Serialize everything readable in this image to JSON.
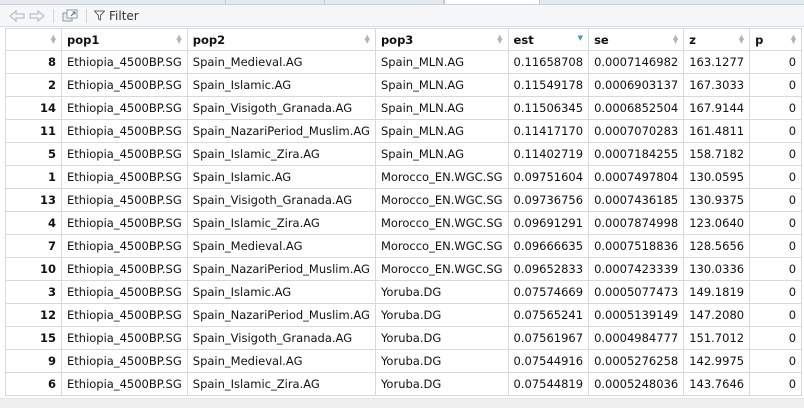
{
  "toolbar": {
    "back_icon": "arrow-left-icon",
    "forward_icon": "arrow-right-icon",
    "popout_icon": "popout-window-icon",
    "filter_icon": "funnel-icon",
    "filter_label": "Filter"
  },
  "table": {
    "columns": [
      "",
      "pop1",
      "pop2",
      "pop3",
      "est",
      "se",
      "z",
      "p"
    ],
    "sorted_column": "est",
    "sort_direction": "descending",
    "accent_color": "#4a90d9",
    "rows": [
      [
        "8",
        "Ethiopia_4500BP.SG",
        "Spain_Medieval.AG",
        "Spain_MLN.AG",
        "0.11658708",
        "0.0007146982",
        "163.1277",
        "0"
      ],
      [
        "2",
        "Ethiopia_4500BP.SG",
        "Spain_Islamic.AG",
        "Spain_MLN.AG",
        "0.11549178",
        "0.0006903137",
        "167.3033",
        "0"
      ],
      [
        "14",
        "Ethiopia_4500BP.SG",
        "Spain_Visigoth_Granada.AG",
        "Spain_MLN.AG",
        "0.11506345",
        "0.0006852504",
        "167.9144",
        "0"
      ],
      [
        "11",
        "Ethiopia_4500BP.SG",
        "Spain_NazariPeriod_Muslim.AG",
        "Spain_MLN.AG",
        "0.11417170",
        "0.0007070283",
        "161.4811",
        "0"
      ],
      [
        "5",
        "Ethiopia_4500BP.SG",
        "Spain_Islamic_Zira.AG",
        "Spain_MLN.AG",
        "0.11402719",
        "0.0007184255",
        "158.7182",
        "0"
      ],
      [
        "1",
        "Ethiopia_4500BP.SG",
        "Spain_Islamic.AG",
        "Morocco_EN.WGC.SG",
        "0.09751604",
        "0.0007497804",
        "130.0595",
        "0"
      ],
      [
        "13",
        "Ethiopia_4500BP.SG",
        "Spain_Visigoth_Granada.AG",
        "Morocco_EN.WGC.SG",
        "0.09736756",
        "0.0007436185",
        "130.9375",
        "0"
      ],
      [
        "4",
        "Ethiopia_4500BP.SG",
        "Spain_Islamic_Zira.AG",
        "Morocco_EN.WGC.SG",
        "0.09691291",
        "0.0007874998",
        "123.0640",
        "0"
      ],
      [
        "7",
        "Ethiopia_4500BP.SG",
        "Spain_Medieval.AG",
        "Morocco_EN.WGC.SG",
        "0.09666635",
        "0.0007518836",
        "128.5656",
        "0"
      ],
      [
        "10",
        "Ethiopia_4500BP.SG",
        "Spain_NazariPeriod_Muslim.AG",
        "Morocco_EN.WGC.SG",
        "0.09652833",
        "0.0007423339",
        "130.0336",
        "0"
      ],
      [
        "3",
        "Ethiopia_4500BP.SG",
        "Spain_Islamic.AG",
        "Yoruba.DG",
        "0.07574669",
        "0.0005077473",
        "149.1819",
        "0"
      ],
      [
        "12",
        "Ethiopia_4500BP.SG",
        "Spain_NazariPeriod_Muslim.AG",
        "Yoruba.DG",
        "0.07565241",
        "0.0005139149",
        "147.2080",
        "0"
      ],
      [
        "15",
        "Ethiopia_4500BP.SG",
        "Spain_Visigoth_Granada.AG",
        "Yoruba.DG",
        "0.07561967",
        "0.0004984777",
        "151.7012",
        "0"
      ],
      [
        "9",
        "Ethiopia_4500BP.SG",
        "Spain_Medieval.AG",
        "Yoruba.DG",
        "0.07544916",
        "0.0005276258",
        "142.9975",
        "0"
      ],
      [
        "6",
        "Ethiopia_4500BP.SG",
        "Spain_Islamic_Zira.AG",
        "Yoruba.DG",
        "0.07544819",
        "0.0005248036",
        "143.7646",
        "0"
      ]
    ]
  }
}
